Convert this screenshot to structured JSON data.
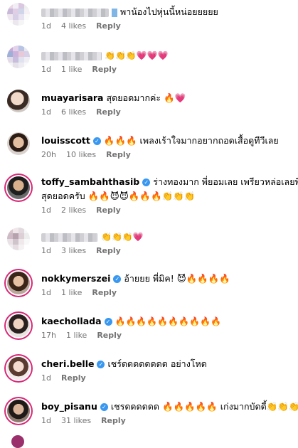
{
  "comments": [
    {
      "user": "",
      "text": "พาน้องไปหุ่นนี้หน่อยยยยย",
      "time": "1d",
      "likes": "4 likes",
      "reply": "Reply"
    },
    {
      "user": "",
      "text": "👏👏👏💗💗💗",
      "time": "1d",
      "likes": "1 like",
      "reply": "Reply"
    },
    {
      "user": "muayarisara",
      "text": "สุดยอดมากค่ะ 🔥💗",
      "time": "1d",
      "likes": "6 likes",
      "reply": "Reply"
    },
    {
      "user": "louisscott",
      "text": "🔥🔥🔥 เพลงเร้าใจมากอยากถอดเสื้อดูทีวีเลย",
      "time": "20h",
      "likes": "10 likes",
      "reply": "Reply"
    },
    {
      "user": "toffy_sambahthasib",
      "text": "ร่างทองมาก พี่ยอมเลย เพรียวหล่อเลยพี่มิค",
      "text2": "สุดยอดครับ 🔥🔥😈😈🔥🔥🔥👏👏👏",
      "time": "1d",
      "likes": "2 likes",
      "reply": "Reply"
    },
    {
      "user": "",
      "text": "👏👏👏💗",
      "time": "1d",
      "likes": "3 likes",
      "reply": "Reply"
    },
    {
      "user": "nokkymerszei",
      "text": "อ้ายยย พี่มิค! 😈🔥🔥🔥🔥",
      "time": "1d",
      "likes": "1 like",
      "reply": "Reply"
    },
    {
      "user": "kaechollada",
      "text": "🔥🔥🔥🔥🔥🔥🔥🔥🔥🔥",
      "time": "17h",
      "likes": "1 like",
      "reply": "Reply"
    },
    {
      "user": "cheri.belle",
      "text": "เชร์ดดดดดดดด อย่างโหด",
      "time": "1d",
      "likes": "",
      "reply": "Reply"
    },
    {
      "user": "boy_pisanu",
      "text": "เชรดดดดดด 🔥🔥🔥🔥🔥 เก่งมากบัดดี้👏👏👏",
      "time": "1d",
      "likes": "31 likes",
      "reply": "Reply"
    }
  ],
  "colors": {
    "meta_text": "#737373",
    "verified": "#3897f0",
    "story_ring": "#d62976"
  }
}
